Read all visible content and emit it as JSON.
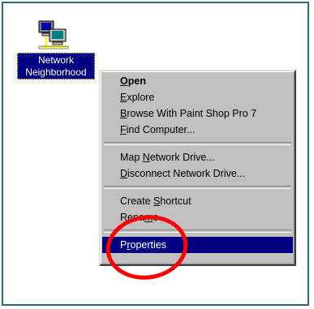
{
  "desktop": {
    "icon_label_line1": "Network",
    "icon_label_line2": "Neighborhood",
    "icon": "network-computers-icon"
  },
  "context_menu": {
    "items": [
      {
        "pre": "",
        "mnem": "O",
        "post": "pen",
        "bold": true
      },
      {
        "pre": "",
        "mnem": "E",
        "post": "xplore"
      },
      {
        "pre": "",
        "mnem": "B",
        "post": "rowse With Paint Shop Pro 7"
      },
      {
        "pre": "",
        "mnem": "F",
        "post": "ind Computer..."
      },
      {
        "pre": "Map ",
        "mnem": "N",
        "post": "etwork Drive..."
      },
      {
        "pre": "",
        "mnem": "D",
        "post": "isconnect Network Drive..."
      },
      {
        "pre": "Create ",
        "mnem": "S",
        "post": "hortcut"
      },
      {
        "pre": "Rena",
        "mnem": "m",
        "post": "e"
      },
      {
        "pre": "P",
        "mnem": "r",
        "post": "operties",
        "selected": true
      }
    ]
  },
  "annotation": {
    "circle_color": "#ff0000",
    "circled_item": "Properties"
  },
  "colors": {
    "frame_border": "#2a6b79",
    "menu_background": "#c0c0c0",
    "selection": "#000080"
  }
}
